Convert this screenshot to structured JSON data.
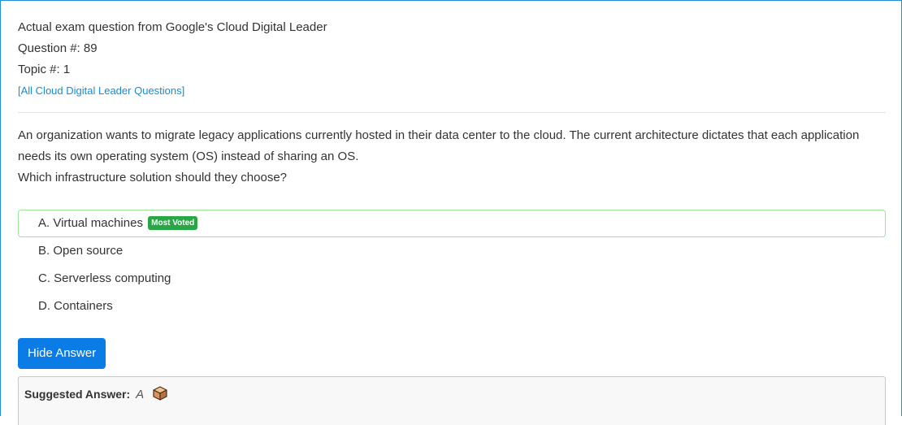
{
  "header": {
    "source_line": "Actual exam question from Google's Cloud Digital Leader",
    "question_number": "Question #: 89",
    "topic_number": "Topic #: 1",
    "all_questions_link": "[All Cloud Digital Leader Questions]"
  },
  "question": {
    "text_line1": "An organization wants to migrate legacy applications currently hosted in their data center to the cloud. The current architecture dictates that each application needs its own operating system (OS) instead of sharing an OS.",
    "text_line2": "Which infrastructure solution should they choose?"
  },
  "choices": [
    {
      "label": "A. Virtual machines",
      "badge": "Most Voted",
      "correct": true
    },
    {
      "label": "B. Open source"
    },
    {
      "label": "C. Serverless computing"
    },
    {
      "label": "D. Containers"
    }
  ],
  "toggle_button_label": "Hide Answer",
  "suggested_answer": {
    "label": "Suggested Answer:",
    "value": "A",
    "icon": "box-icon"
  },
  "colors": {
    "accent": "#0b7be6",
    "link": "#1a8bd0",
    "badge": "#28a745",
    "correct_border": "#9be39b"
  }
}
